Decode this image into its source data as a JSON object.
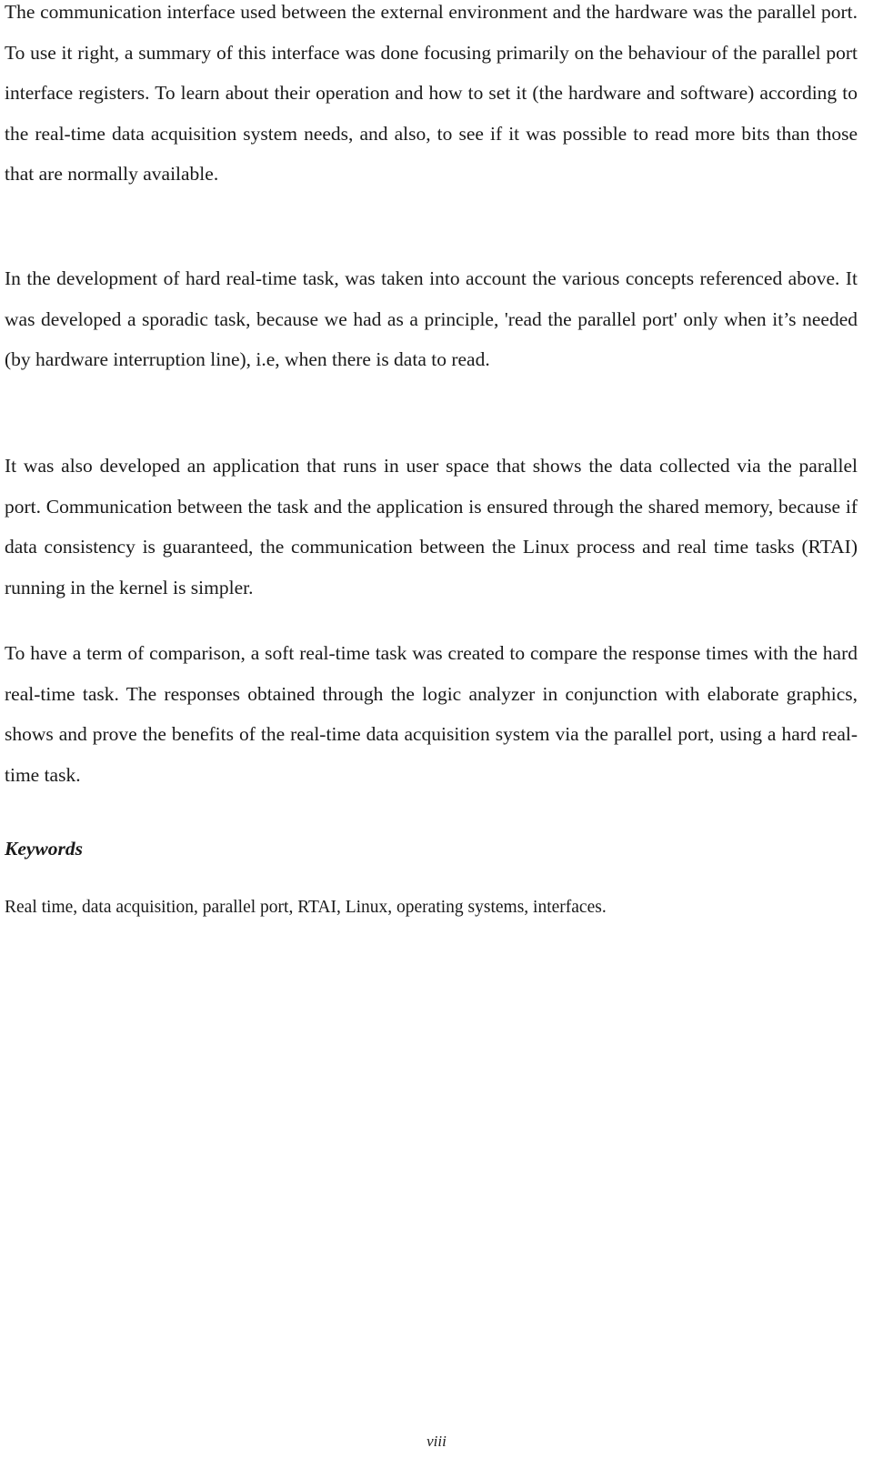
{
  "document": {
    "paragraphs": [
      "The communication interface used between the external environment and the hardware was the parallel port.  To use it right, a summary of this interface was done focusing primarily on the behaviour of the parallel port interface registers. To learn about their operation and how to set it (the hardware and software) according to the real-time data acquisition system needs, and also, to see if it was possible to read more bits than those that are normally available.",
      "In the development of hard real-time task, was taken into account the various concepts referenced above. It was developed a sporadic task, because we had as a principle, 'read the parallel port' only when it’s needed (by hardware interruption line), i.e, when there is data to read.",
      "It was also developed an application that runs in user space that shows the data collected via the parallel port. Communication between the task and the application is ensured through the shared memory, because if data consistency is guaranteed, the communication between the Linux process and real time tasks (RTAI) running in the kernel is simpler.",
      "To have a term of comparison, a soft real-time task was created to compare the response times with the hard real-time task. The responses obtained through the logic analyzer in conjunction with elaborate graphics, shows and prove the benefits of the real-time data acquisition system via the parallel port, using a hard real-time task."
    ],
    "keywords": {
      "heading": "Keywords",
      "text": "Real time, data acquisition, parallel port, RTAI, Linux, operating systems, interfaces."
    },
    "page_number": "viii"
  }
}
